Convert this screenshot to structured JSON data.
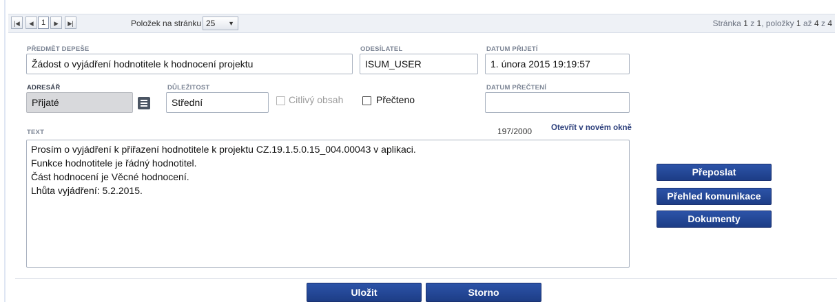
{
  "pager": {
    "first_icon": "first-page-icon",
    "prev_icon": "prev-page-icon",
    "page_value": "1",
    "next_icon": "next-page-icon",
    "last_icon": "last-page-icon",
    "per_page_label": "Položek na stránku",
    "per_page_value": "25",
    "info_prefix": "Stránka ",
    "info_page": "1",
    "info_mid1": " z ",
    "info_total_pages": "1",
    "info_mid2": ", položky ",
    "info_from": "1",
    "info_mid3": " až ",
    "info_to": "4",
    "info_mid4": " z ",
    "info_total": "4"
  },
  "form": {
    "subject_label": "Předmět depeše",
    "subject_value": "Žádost o vyjádření hodnotitele k hodnocení projektu",
    "sender_label": "Odesílatel",
    "sender_value": "ISUM_USER",
    "received_label": "Datum přijetí",
    "received_value": "1. února 2015 19:19:57",
    "folder_label": "Adresář",
    "folder_value": "Přijaté",
    "folder_button_icon": "list-icon",
    "importance_label": "Důležitost",
    "importance_value": "Střední",
    "sensitive_label": "Citlivý obsah",
    "sensitive_checked": false,
    "read_label": "Přečteno",
    "read_checked": false,
    "read_date_label": "Datum přečtení",
    "read_date_value": "",
    "text_label": "Text",
    "char_count": "197/2000",
    "open_new_window": "Otevřít v novém okně",
    "text_lines": [
      "Prosím o vyjádření k přiřazení hodnotitele k projektu CZ.19.1.5.0.15_004.00043 v aplikaci.",
      "Funkce hodnotitele je řádný hodnotitel.",
      "Část hodnocení je Věcné hodnocení.",
      "Lhůta vyjádření: 5.2.2015."
    ]
  },
  "actions": {
    "forward": "Přeposlat",
    "overview": "Přehled komunikace",
    "documents": "Dokumenty",
    "save": "Uložit",
    "cancel": "Storno"
  },
  "colors": {
    "button_blue": "#1f418d",
    "label_grey": "#7c8595",
    "link_blue": "#2a3d7a"
  }
}
